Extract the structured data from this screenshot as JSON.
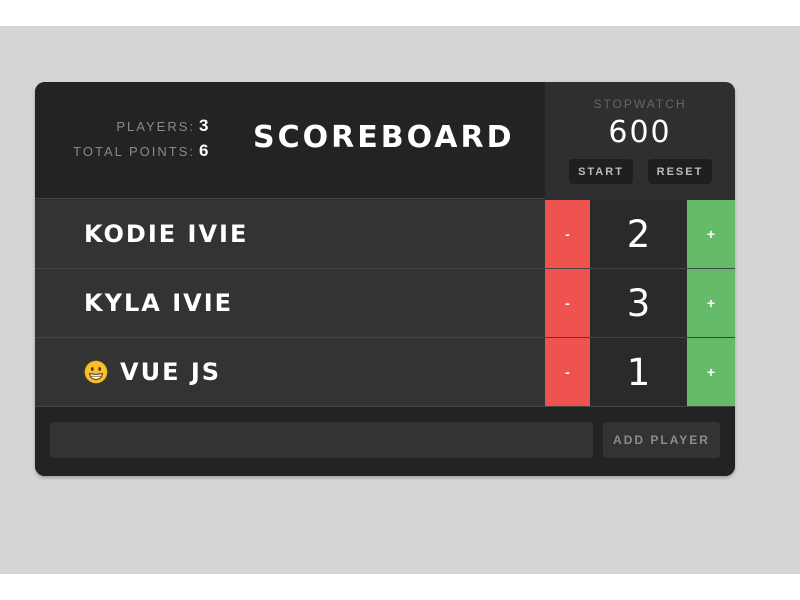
{
  "header": {
    "players_label": "PLAYERS:",
    "players_count": "3",
    "points_label": "TOTAL POINTS:",
    "points_total": "6",
    "title": "SCOREBOARD"
  },
  "stopwatch": {
    "label": "STOPWATCH",
    "time": "600",
    "start_label": "START",
    "reset_label": "RESET"
  },
  "players": [
    {
      "name": "KODIE IVIE",
      "score": "2",
      "minus_label": "-",
      "plus_label": "+",
      "icon": null
    },
    {
      "name": "KYLA IVIE",
      "score": "3",
      "minus_label": "-",
      "plus_label": "+",
      "icon": null
    },
    {
      "name": "VUE JS",
      "score": "1",
      "minus_label": "-",
      "plus_label": "+",
      "icon": "grinning-emoji-icon"
    }
  ],
  "add_player": {
    "input_value": "",
    "input_placeholder": "",
    "button_label": "ADD PLAYER"
  },
  "colors": {
    "minus": "#ef5350",
    "plus": "#66bb6a",
    "board": "#2b2b2b",
    "header": "#232323"
  }
}
